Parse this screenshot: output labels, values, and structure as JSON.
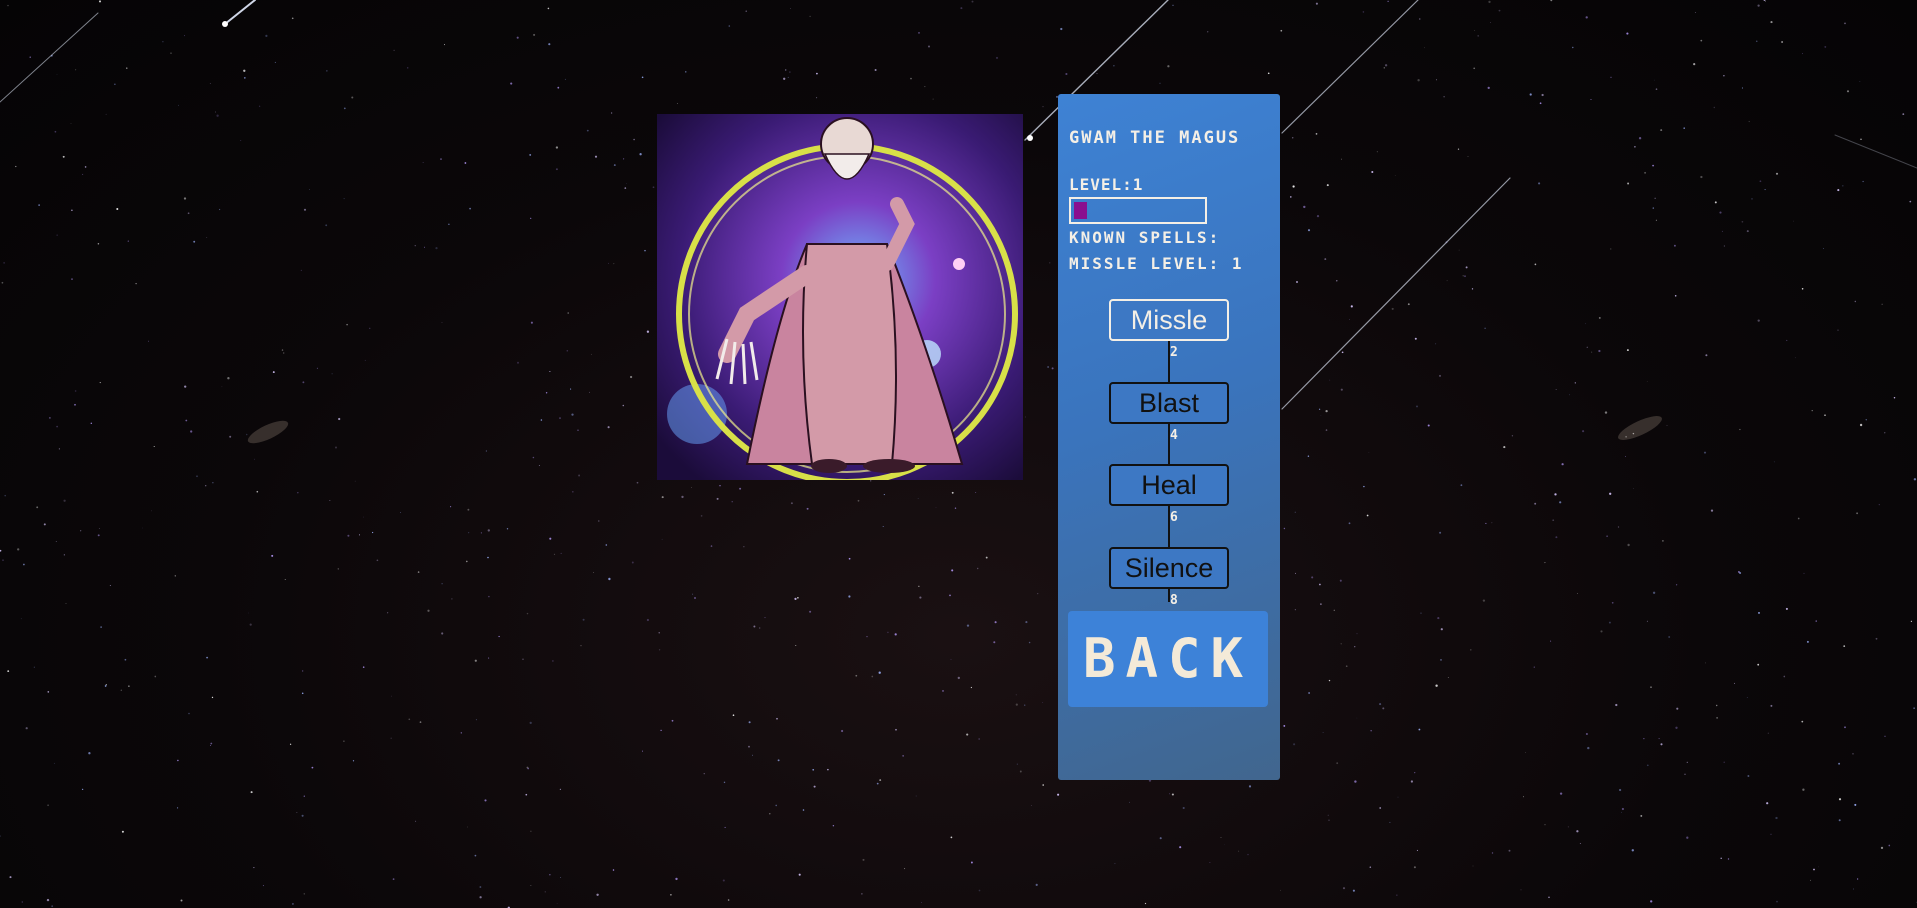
{
  "character": {
    "name": "GWAM THE MAGUS",
    "level_label": "LEVEL:1",
    "xp_fraction": 0.1,
    "xp_color": "#8a0f8f",
    "portrait_icon": "wizard-portrait"
  },
  "spells": {
    "known_label": "KNOWN SPELLS:",
    "level_line": "MISSLE LEVEL: 1",
    "tree": [
      {
        "name": "Missle",
        "cost": "2",
        "learned": true
      },
      {
        "name": "Blast",
        "cost": "4",
        "learned": false
      },
      {
        "name": "Heal",
        "cost": "6",
        "learned": false
      },
      {
        "name": "Silence",
        "cost": "8",
        "learned": false
      }
    ]
  },
  "back_label": "BACK",
  "colors": {
    "panel": "#3e82d4",
    "text": "#f4efe6",
    "background": "#0b0709"
  }
}
